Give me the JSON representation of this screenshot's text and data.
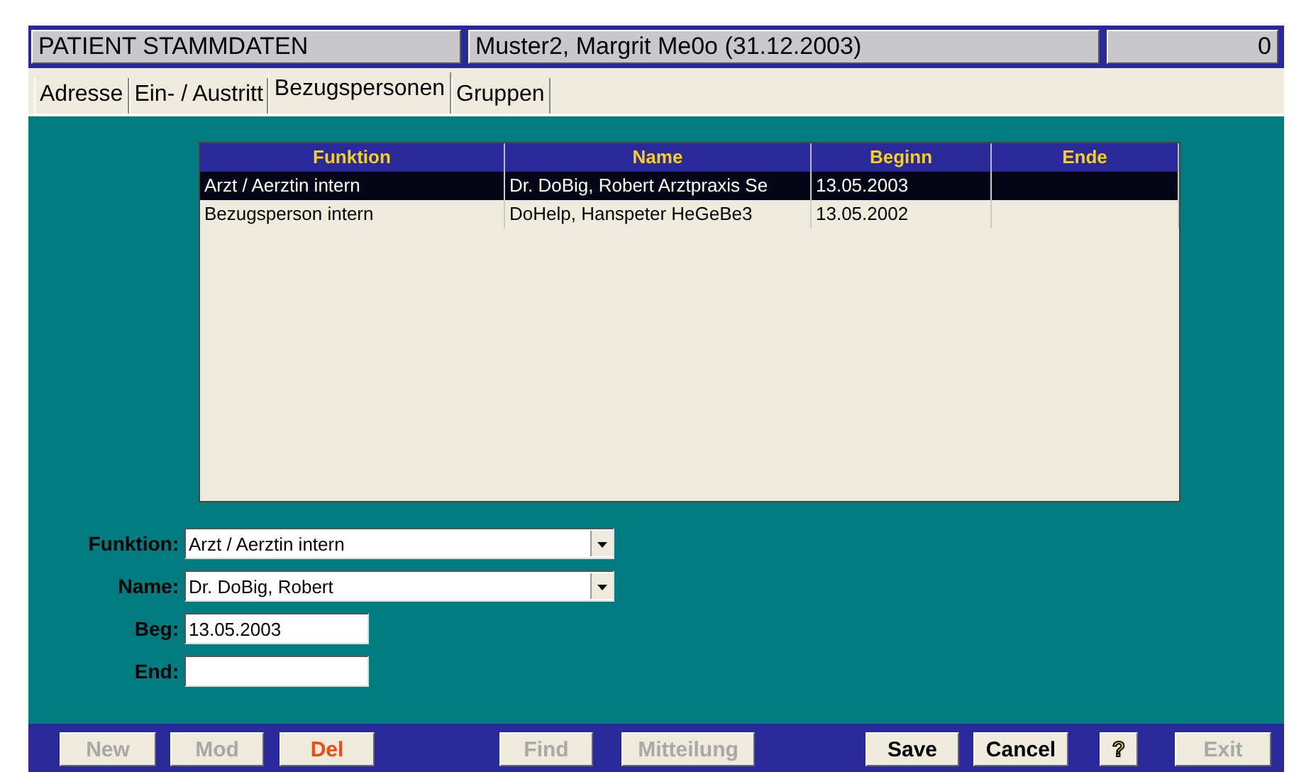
{
  "header": {
    "title": "PATIENT STAMMDATEN",
    "patient": "Muster2, Margrit Me0o (31.12.2003)",
    "count": "0"
  },
  "tabs": [
    {
      "label": "Adresse",
      "selected": false
    },
    {
      "label": "Ein- / Austritt",
      "selected": false
    },
    {
      "label": "Bezugspersonen",
      "selected": true
    },
    {
      "label": "Gruppen",
      "selected": false
    }
  ],
  "table": {
    "columns": [
      "Funktion",
      "Name",
      "Beginn",
      "Ende"
    ],
    "rows": [
      {
        "cells": [
          "Arzt / Aerztin intern",
          "Dr. DoBig, Robert Arztpraxis Se",
          "13.05.2003"
        ],
        "selected": true
      },
      {
        "cells": [
          "Bezugsperson intern",
          "DoHelp, Hanspeter HeGeBe3",
          "13.05.2002"
        ],
        "selected": false
      }
    ]
  },
  "form": [
    {
      "label": "Funktion:",
      "kind": "dropdown",
      "value": "Arzt / Aerztin intern"
    },
    {
      "label": "Name:",
      "kind": "dropdown",
      "value": "Dr. DoBig, Robert"
    },
    {
      "label": "Beg:",
      "kind": "text",
      "value": "13.05.2003"
    },
    {
      "label": "End:",
      "kind": "text"
    }
  ],
  "buttons": [
    {
      "label": "New",
      "kind": "text",
      "disabled": true
    },
    {
      "label": "Mod",
      "kind": "text",
      "disabled": true
    },
    {
      "label": "Del",
      "kind": "danger",
      "disabled": false
    },
    {
      "label": "Find",
      "kind": "text",
      "disabled": true
    },
    {
      "label": "Mitteilung",
      "kind": "text",
      "disabled": true
    },
    {
      "label": "Save",
      "kind": "text",
      "disabled": false
    },
    {
      "label": "Cancel",
      "kind": "text",
      "disabled": false
    },
    {
      "label": "?",
      "kind": "help",
      "disabled": false
    },
    {
      "label": "Exit",
      "kind": "text",
      "disabled": true
    }
  ]
}
